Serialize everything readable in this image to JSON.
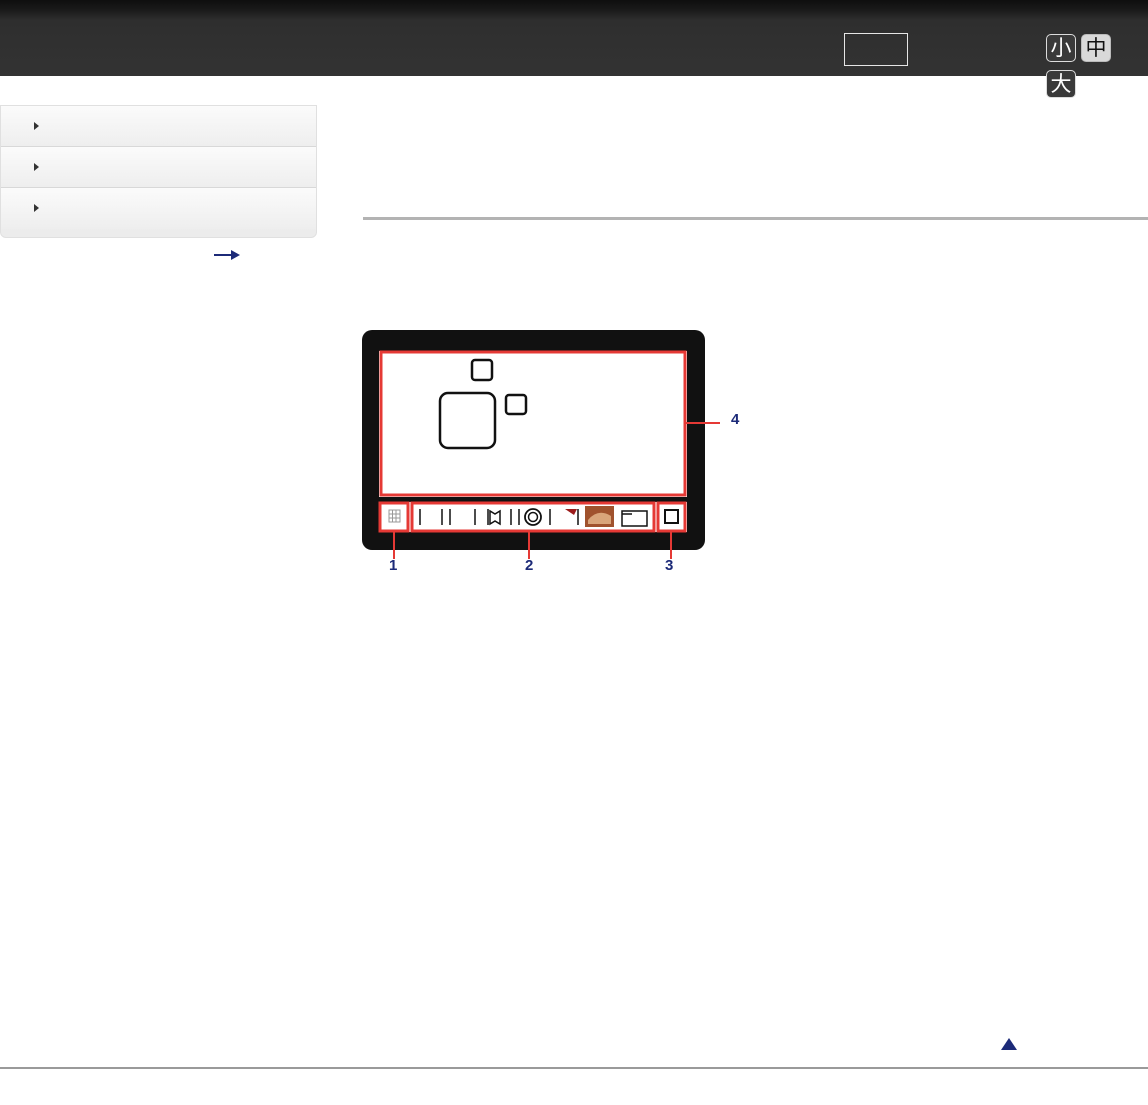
{
  "header": {
    "font_size_buttons": {
      "small": "小",
      "medium": "中",
      "large": "大"
    }
  },
  "sidebar": {
    "items": [
      {
        "icon": "triangle-right-icon"
      },
      {
        "icon": "triangle-right-icon"
      },
      {
        "icon": "triangle-right-icon"
      }
    ],
    "link_icon": "arrow-right-icon"
  },
  "diagram": {
    "callouts": {
      "c1": "1",
      "c2": "2",
      "c3": "3",
      "c4": "4"
    }
  },
  "footer": {
    "back_to_top_icon": "triangle-up-icon"
  },
  "colors": {
    "accent_navy": "#1c2a78",
    "highlight_red": "#e53935"
  }
}
